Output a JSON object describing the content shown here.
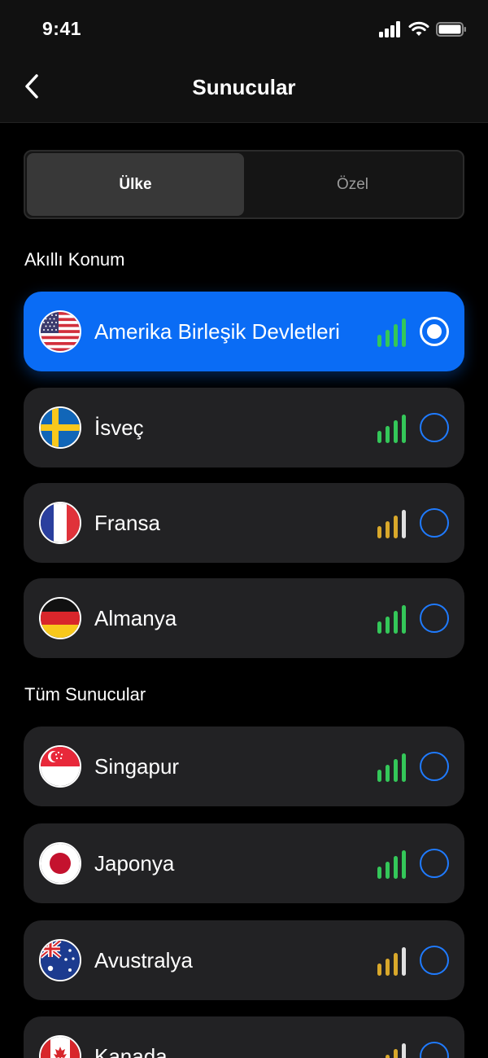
{
  "status_bar": {
    "time": "9:41",
    "icons": [
      "signal-icon",
      "wifi-icon",
      "battery-icon"
    ]
  },
  "nav": {
    "title": "Sunucular",
    "back_icon": "chevron-left-icon"
  },
  "tabs": [
    {
      "label": "Ülke",
      "active": true
    },
    {
      "label": "Özel",
      "active": false
    }
  ],
  "sections": {
    "smart": "Akıllı Konum",
    "all": "Tüm Sunucular"
  },
  "smart_servers": [
    {
      "name": "Amerika Birleşik Devletleri",
      "flag": "us-flag-icon",
      "signal_level": 4,
      "signal_color": "#34c759",
      "selected": true
    },
    {
      "name": "İsveç",
      "flag": "sweden-flag-icon",
      "signal_level": 4,
      "signal_color": "#34c759",
      "selected": false
    },
    {
      "name": "Fransa",
      "flag": "france-flag-icon",
      "signal_level": 3,
      "signal_color": "#d9a82b",
      "selected": false
    },
    {
      "name": "Almanya",
      "flag": "germany-flag-icon",
      "signal_level": 4,
      "signal_color": "#34c759",
      "selected": false
    }
  ],
  "all_servers": [
    {
      "name": "Singapur",
      "flag": "singapore-flag-icon",
      "signal_level": 4,
      "signal_color": "#34c759",
      "selected": false
    },
    {
      "name": "Japonya",
      "flag": "japan-flag-icon",
      "signal_level": 4,
      "signal_color": "#34c759",
      "selected": false
    },
    {
      "name": "Avustralya",
      "flag": "australia-flag-icon",
      "signal_level": 3,
      "signal_color": "#d9a82b",
      "selected": false
    },
    {
      "name": "Kanada",
      "flag": "canada-flag-icon",
      "signal_level": 3,
      "signal_color": "#d9a82b",
      "selected": false
    }
  ],
  "colors": {
    "accent": "#0a6cf5",
    "signal_good": "#34c759",
    "signal_medium": "#d9a82b",
    "signal_off": "#e0e0e0"
  }
}
